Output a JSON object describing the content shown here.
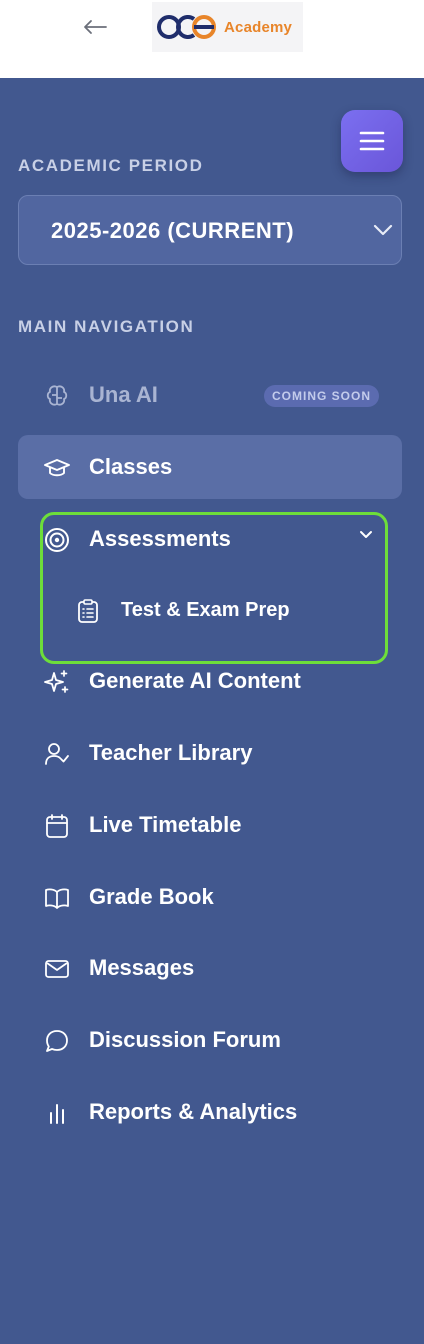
{
  "topbar": {
    "back_label": "←",
    "logo_mark": "ooe",
    "logo_text": "Academy"
  },
  "sidebar": {
    "academic_period_heading": "ACADEMIC PERIOD",
    "academic_period_value": "2025-2026 (CURRENT)",
    "main_navigation_heading": "MAIN NAVIGATION",
    "items": [
      {
        "label": "Una AI",
        "icon": "brain-icon",
        "state": "disabled",
        "badge": "COMING SOON"
      },
      {
        "label": "Classes",
        "icon": "graduation-cap-icon",
        "state": "active"
      },
      {
        "label": "Assessments",
        "icon": "target-icon",
        "state": "expanded"
      },
      {
        "label": "Test & Exam Prep",
        "icon": "clipboard-list-icon",
        "state": "sub-item"
      },
      {
        "label": "Generate AI Content",
        "icon": "sparkles-icon"
      },
      {
        "label": "Teacher Library",
        "icon": "user-check-icon"
      },
      {
        "label": "Live Timetable",
        "icon": "calendar-icon"
      },
      {
        "label": "Grade Book",
        "icon": "book-open-icon"
      },
      {
        "label": "Messages",
        "icon": "mail-icon"
      },
      {
        "label": "Discussion Forum",
        "icon": "message-circle-icon"
      },
      {
        "label": "Reports & Analytics",
        "icon": "bar-chart-icon"
      }
    ]
  },
  "colors": {
    "sidebar_bg": "#42588f",
    "active_item_bg": "#5a6ea6",
    "menu_button": "#7366e8",
    "highlight": "#6dde3a",
    "logo_orange": "#e8852a",
    "logo_navy": "#1f2d6b"
  }
}
